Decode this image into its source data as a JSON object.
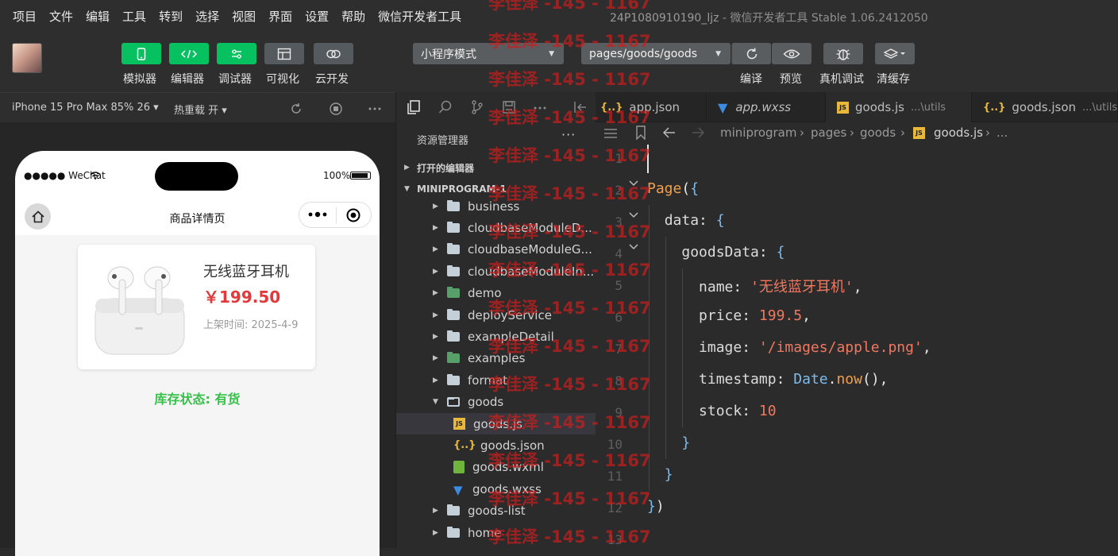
{
  "menu": [
    "项目",
    "文件",
    "编辑",
    "工具",
    "转到",
    "选择",
    "视图",
    "界面",
    "设置",
    "帮助",
    "微信开发者工具"
  ],
  "window_title": {
    "project": "24P1080910190_ljz",
    "separator": " - ",
    "app": "微信开发者工具 Stable 1.06.2412050"
  },
  "toolbar": {
    "simulator": "模拟器",
    "editor": "编辑器",
    "debugger": "调试器",
    "visual": "可视化",
    "cloud": "云开发",
    "mode_select": "小程序模式",
    "page_select": "pages/goods/goods",
    "compile": "编译",
    "preview": "预览",
    "real_debug": "真机调试",
    "clear_cache": "清缓存"
  },
  "simulator": {
    "device": "iPhone 15 Pro Max 85% 26 ▾",
    "hot_reload": "热重载 开 ▾",
    "carrier": "●●●●● WeChat",
    "battery": "100%",
    "page_title": "商品详情页",
    "product": {
      "name": "无线蓝牙耳机",
      "price": "￥199.50",
      "time": "上架时间: 2025-4-9"
    },
    "stock_status": "库存状态: 有货"
  },
  "explorer": {
    "title": "资源管理器",
    "more": "···",
    "open_editors": "打开的编辑器",
    "project": "MINIPROGRAM-1",
    "items": [
      {
        "label": "business",
        "type": "folder"
      },
      {
        "label": "cloudbaseModuleD...",
        "type": "folder"
      },
      {
        "label": "cloudbaseModuleG...",
        "type": "folder"
      },
      {
        "label": "cloudbaseModuleIn...",
        "type": "folder"
      },
      {
        "label": "demo",
        "type": "folder-demo"
      },
      {
        "label": "deployService",
        "type": "folder"
      },
      {
        "label": "exampleDetail",
        "type": "folder"
      },
      {
        "label": "examples",
        "type": "folder-demo"
      },
      {
        "label": "format",
        "type": "folder"
      },
      {
        "label": "goods",
        "type": "folder-open"
      },
      {
        "label": "goods.js",
        "type": "js"
      },
      {
        "label": "goods.json",
        "type": "json"
      },
      {
        "label": "goods.wxml",
        "type": "wxml"
      },
      {
        "label": "goods.wxss",
        "type": "wxss"
      },
      {
        "label": "goods-list",
        "type": "folder"
      },
      {
        "label": "home",
        "type": "folder"
      }
    ]
  },
  "tabs": [
    {
      "label": "app.json",
      "icon": "{..}",
      "suffix": ""
    },
    {
      "label": "app.wxss",
      "icon": "css",
      "suffix": ""
    },
    {
      "label": "goods.js",
      "icon": "JS",
      "suffix": "...\\utils"
    },
    {
      "label": "goods.json",
      "icon": "{..}",
      "suffix": "...\\utils"
    }
  ],
  "breadcrumb": [
    "miniprogram",
    "pages",
    "goods",
    "goods.js",
    "..."
  ],
  "code": {
    "line_numbers": [
      "1",
      "2",
      "3",
      "4",
      "5",
      "6",
      "7",
      "8",
      "9",
      "10",
      "11",
      "12",
      "13"
    ],
    "lines": [
      "",
      "Page({",
      "  data: {",
      "    goodsData: {",
      "      name: '无线蓝牙耳机',",
      "      price: 199.5,",
      "      image: '/images/apple.png',",
      "      timestamp: Date.now(),",
      "      stock: 10",
      "    }",
      "  }",
      "})",
      ""
    ]
  },
  "watermark": "李佳泽 -145 - 1167",
  "colors": {
    "accent_green": "#07c160",
    "price_red": "#e4393c",
    "stock_green": "#36c24a",
    "watermark_red": "#c81e1e"
  }
}
